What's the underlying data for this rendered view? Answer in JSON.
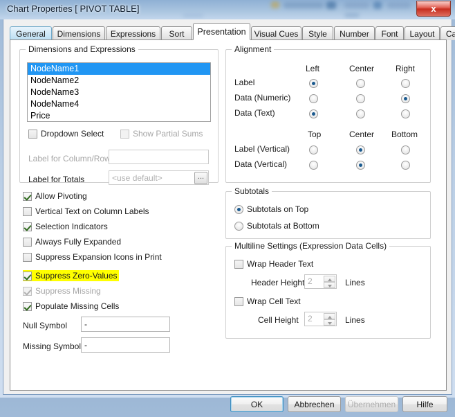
{
  "window": {
    "title": "Chart Properties [ PIVOT TABLE]",
    "close_label": "x"
  },
  "tabs": [
    {
      "label": "General",
      "state": "hover"
    },
    {
      "label": "Dimensions",
      "state": "normal"
    },
    {
      "label": "Expressions",
      "state": "normal"
    },
    {
      "label": "Sort",
      "state": "normal"
    },
    {
      "label": "Presentation",
      "state": "active"
    },
    {
      "label": "Visual Cues",
      "state": "normal"
    },
    {
      "label": "Style",
      "state": "normal"
    },
    {
      "label": "Number",
      "state": "normal"
    },
    {
      "label": "Font",
      "state": "normal"
    },
    {
      "label": "Layout",
      "state": "normal"
    },
    {
      "label": "Caption",
      "state": "normal"
    }
  ],
  "dimensions_group": {
    "legend": "Dimensions and Expressions",
    "items": [
      {
        "label": "NodeName1",
        "selected": true
      },
      {
        "label": "NodeName2",
        "selected": false
      },
      {
        "label": "NodeName3",
        "selected": false
      },
      {
        "label": "NodeName4",
        "selected": false
      },
      {
        "label": "Price",
        "selected": false
      }
    ],
    "dropdown_select": {
      "label": "Dropdown Select",
      "checked": false,
      "enabled": true
    },
    "show_partial_sums": {
      "label": "Show Partial Sums",
      "checked": false,
      "enabled": false
    },
    "label_for_column_row": {
      "label": "Label for Column/Row",
      "value": "",
      "enabled": false
    },
    "label_for_totals": {
      "label": "Label for Totals",
      "value": "<use default>",
      "enabled": false,
      "ellipsis": "..."
    }
  },
  "alignment_group": {
    "legend": "Alignment",
    "horizontal_headers": [
      "Left",
      "Center",
      "Right"
    ],
    "horizontal_rows": [
      {
        "label": "Label",
        "selected": 0
      },
      {
        "label": "Data (Numeric)",
        "selected": 2
      },
      {
        "label": "Data (Text)",
        "selected": 0
      }
    ],
    "vertical_headers": [
      "Top",
      "Center",
      "Bottom"
    ],
    "vertical_rows": [
      {
        "label": "Label (Vertical)",
        "selected": 1
      },
      {
        "label": "Data (Vertical)",
        "selected": 1
      }
    ]
  },
  "options": [
    {
      "label": "Allow Pivoting",
      "checked": true,
      "enabled": true,
      "highlighted": false
    },
    {
      "label": "Vertical Text on Column Labels",
      "checked": false,
      "enabled": true,
      "highlighted": false
    },
    {
      "label": "Selection Indicators",
      "checked": true,
      "enabled": true,
      "highlighted": false
    },
    {
      "label": "Always Fully Expanded",
      "checked": false,
      "enabled": true,
      "highlighted": false
    },
    {
      "label": "Suppress Expansion Icons in Print",
      "checked": false,
      "enabled": true,
      "highlighted": false
    },
    {
      "label": "Suppress Zero-Values",
      "checked": true,
      "enabled": true,
      "highlighted": true
    },
    {
      "label": "Suppress Missing",
      "checked": true,
      "enabled": false,
      "highlighted": false
    },
    {
      "label": "Populate Missing Cells",
      "checked": true,
      "enabled": true,
      "highlighted": false
    }
  ],
  "symbols": {
    "null_symbol": {
      "label": "Null Symbol",
      "value": "-"
    },
    "missing_symbol": {
      "label": "Missing Symbol",
      "value": "-"
    }
  },
  "subtotals_group": {
    "legend": "Subtotals",
    "options": [
      {
        "label": "Subtotals on Top",
        "selected": true
      },
      {
        "label": "Subtotals at Bottom",
        "selected": false
      }
    ]
  },
  "multiline_group": {
    "legend": "Multiline Settings (Expression Data Cells)",
    "wrap_header_text": {
      "label": "Wrap Header Text",
      "checked": false
    },
    "header_height": {
      "label": "Header Height",
      "value": "2",
      "unit": "Lines"
    },
    "wrap_cell_text": {
      "label": "Wrap Cell Text",
      "checked": false
    },
    "cell_height": {
      "label": "Cell Height",
      "value": "2",
      "unit": "Lines"
    }
  },
  "footer": {
    "ok": {
      "label": "OK",
      "enabled": true,
      "default": true
    },
    "cancel": {
      "label": "Abbrechen",
      "enabled": true,
      "default": false
    },
    "apply": {
      "label": "Übernehmen",
      "enabled": false,
      "default": false
    },
    "help": {
      "label": "Hilfe",
      "enabled": true,
      "default": false
    }
  },
  "colors": {
    "selection_blue": "#2196f3",
    "highlight_yellow": "#ffff00",
    "radio_dot": "#1b5a8f",
    "close_red": "#c62d1f"
  }
}
